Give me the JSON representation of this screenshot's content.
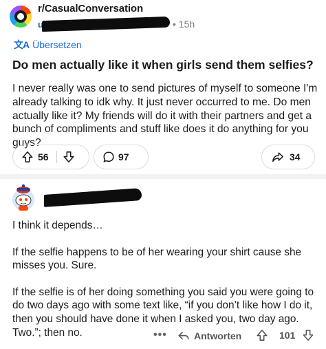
{
  "post": {
    "subreddit": "r/CasualConversation",
    "user_stub": "u",
    "time": "• 15h",
    "translate_label": "Übersetzen",
    "title": "Do men actually like it when girls send them selfies?",
    "body": "I never really was one to send pictures of myself to someone I'm already talking to idk why. It just never occurred to me. Do men actually like it? My friends will do it with their partners and get a bunch of compliments and stuff like does it do anything for you guys?",
    "upvotes": "56",
    "comments": "97",
    "shares": "34"
  },
  "comment": {
    "paragraphs": [
      "I think it depends…",
      "If the selfie happens to be of her wearing your shirt cause she misses you.  Sure.",
      "If the selfie is of her doing something you said you were going to do two days ago with some text like, “if you don’t like how I do it, then you should have done it when I asked you, two day ago.  Two.”; then no."
    ],
    "more_label": "•••",
    "reply_label": "Antworten",
    "votes": "101"
  },
  "icons": {
    "translate": "translate-icon",
    "upvote": "arrow-up-icon",
    "downvote": "arrow-down-icon",
    "comment": "speech-bubble-icon",
    "share": "share-arrow-icon",
    "reply": "reply-arrow-icon"
  }
}
